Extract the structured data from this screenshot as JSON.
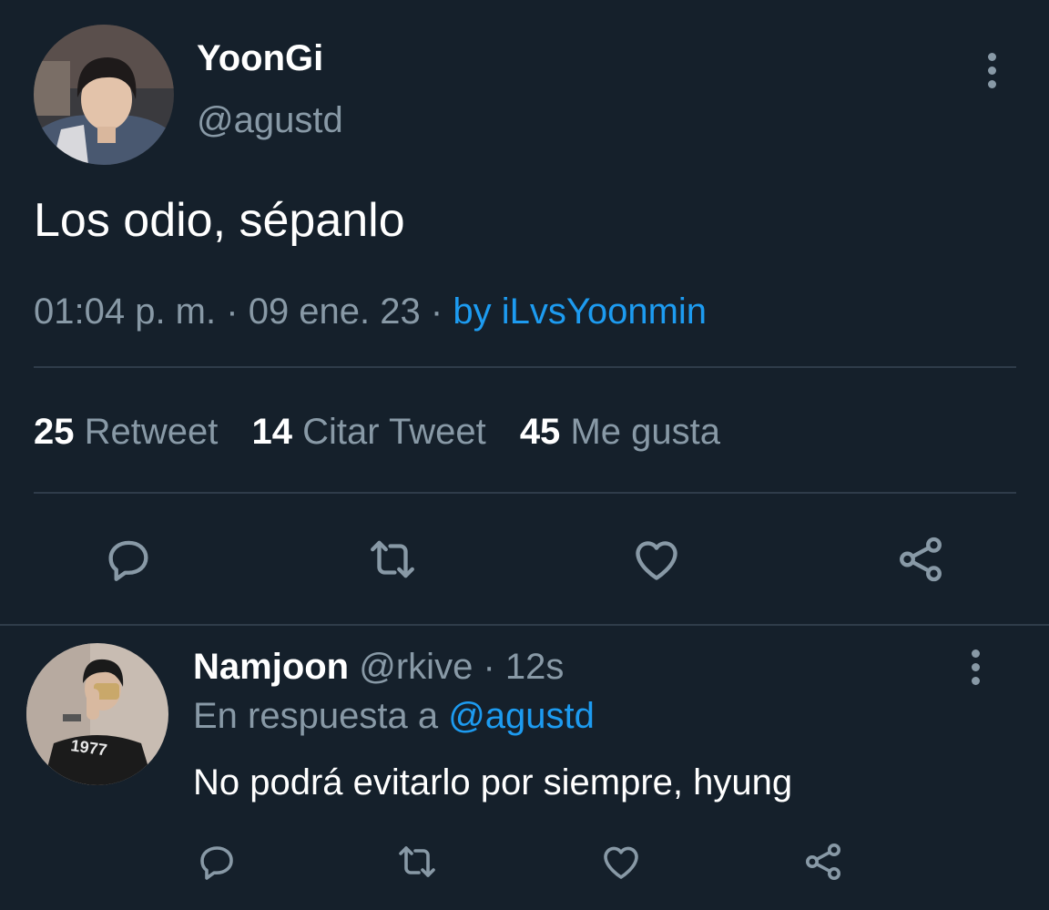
{
  "tweet": {
    "author_name": "YoonGi",
    "author_handle": "@agustd",
    "text": "Los odio, sépanlo",
    "time": "01:04 p. m.",
    "date_sep": "·",
    "date": "09 ene. 23",
    "source_sep": "·",
    "source": "by iLvsYoonmin",
    "stats": {
      "retweets_count": "25",
      "retweets_label": "Retweet",
      "quotes_count": "14",
      "quotes_label": "Citar Tweet",
      "likes_count": "45",
      "likes_label": "Me gusta"
    },
    "icons": {
      "more": "more-vertical-icon",
      "reply": "reply-icon",
      "retweet": "retweet-icon",
      "like": "heart-icon",
      "share": "share-icon"
    }
  },
  "reply": {
    "author_name": "Namjoon",
    "author_handle": "@rkive",
    "time_sep": "·",
    "time_ago": "12s",
    "replying_to_label": "En respuesta a",
    "replying_to_handle": "@agustd",
    "text": "No podrá evitarlo por siempre, hyung",
    "avatar_shirt_text": "1977"
  },
  "colors": {
    "background": "#15202b",
    "primary_text": "#ffffff",
    "secondary_text": "#8899a6",
    "link": "#1d9bf0",
    "divider": "#2f3c4a"
  }
}
